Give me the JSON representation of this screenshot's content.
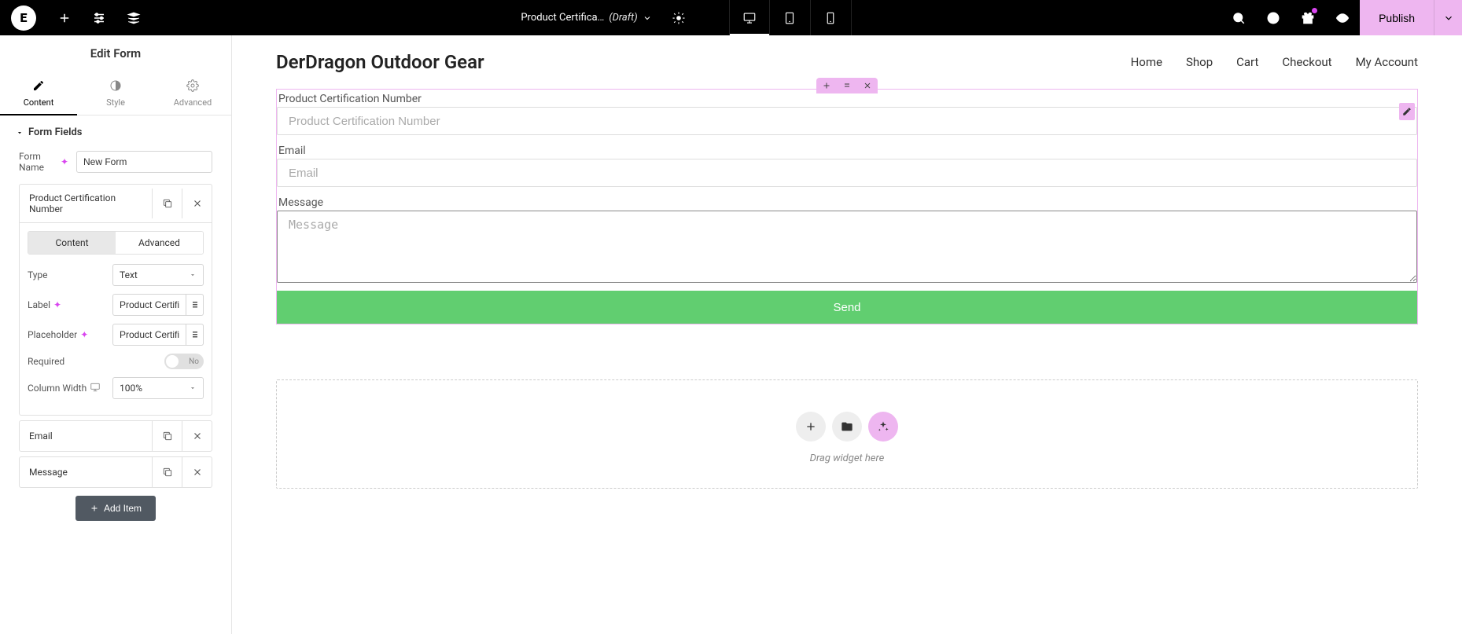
{
  "topbar": {
    "doc_title": "Product Certifica…",
    "doc_status": "(Draft)",
    "publish_label": "Publish"
  },
  "sidebar": {
    "header": "Edit Form",
    "tabs": {
      "content": "Content",
      "style": "Style",
      "advanced": "Advanced"
    },
    "section_title": "Form Fields",
    "form_name_label": "Form Name",
    "form_name_value": "New Form",
    "field_items": [
      {
        "title": "Product Certification Number"
      },
      {
        "title": "Email"
      },
      {
        "title": "Message"
      }
    ],
    "inner_tabs": {
      "content": "Content",
      "advanced": "Advanced"
    },
    "type_label": "Type",
    "type_value": "Text",
    "label_label": "Label",
    "label_value": "Product Certification Number",
    "placeholder_label": "Placeholder",
    "placeholder_value": "Product Certification Number",
    "required_label": "Required",
    "required_value": "No",
    "colwidth_label": "Column Width",
    "colwidth_value": "100%",
    "add_item_label": "Add Item"
  },
  "site": {
    "logo": "DerDragon Outdoor Gear",
    "nav": [
      "Home",
      "Shop",
      "Cart",
      "Checkout",
      "My Account"
    ]
  },
  "form_preview": {
    "f1_label": "Product Certification Number",
    "f1_placeholder": "Product Certification Number",
    "f2_label": "Email",
    "f2_placeholder": "Email",
    "f3_label": "Message",
    "f3_placeholder": "Message",
    "submit_label": "Send"
  },
  "dropzone": {
    "text": "Drag widget here"
  }
}
